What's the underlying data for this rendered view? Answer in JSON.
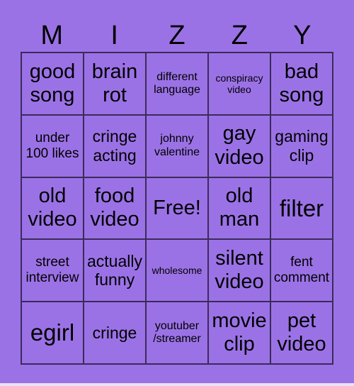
{
  "header": [
    "M",
    "I",
    "Z",
    "Z",
    "Y"
  ],
  "cells": [
    {
      "label": "good song",
      "size": "s5"
    },
    {
      "label": "brain rot",
      "size": "s5"
    },
    {
      "label": "different language",
      "size": "s2"
    },
    {
      "label": "conspiracy video",
      "size": "s1"
    },
    {
      "label": "bad song",
      "size": "s5"
    },
    {
      "label": "under 100 likes",
      "size": "s3"
    },
    {
      "label": "cringe acting",
      "size": "s4"
    },
    {
      "label": "johnny valentine",
      "size": "s2"
    },
    {
      "label": "gay video",
      "size": "s5"
    },
    {
      "label": "gaming clip",
      "size": "s4"
    },
    {
      "label": "old video",
      "size": "s5"
    },
    {
      "label": "food video",
      "size": "s5"
    },
    {
      "label": "Free!",
      "size": "s5"
    },
    {
      "label": "old man",
      "size": "s5"
    },
    {
      "label": "filter",
      "size": "s6"
    },
    {
      "label": "street interview",
      "size": "s3"
    },
    {
      "label": "actually funny",
      "size": "s4"
    },
    {
      "label": "wholesome",
      "size": "s1"
    },
    {
      "label": "silent video",
      "size": "s5"
    },
    {
      "label": "fent comment",
      "size": "s3"
    },
    {
      "label": "egirl",
      "size": "s6"
    },
    {
      "label": "cringe",
      "size": "s4"
    },
    {
      "label": "youtuber /streamer",
      "size": "s2"
    },
    {
      "label": "movie clip",
      "size": "s5"
    },
    {
      "label": "pet video",
      "size": "s5"
    }
  ]
}
